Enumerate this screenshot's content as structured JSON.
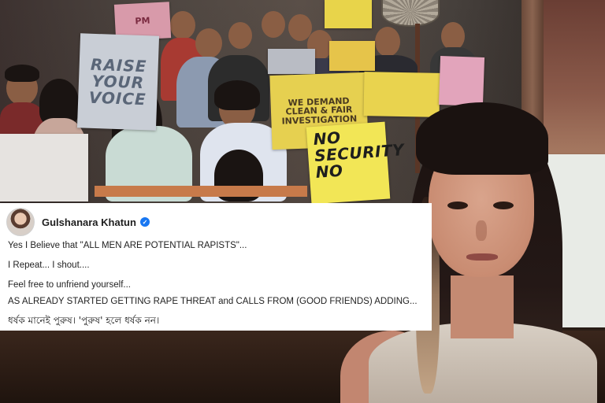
{
  "placards": {
    "raise": "RAISE YOUR VOICE",
    "no_security": "NO SECURITY NO",
    "we_demand": "WE DEMAND CLEAN & FAIR INVESTIGATION"
  },
  "tweet": {
    "author": "Gulshanara Khatun",
    "verified_mark": "✓",
    "lines": [
      "Yes I Believe that \"ALL MEN ARE POTENTIAL RAPISTS\"...",
      "I Repeat... I shout....",
      "Feel free to unfriend yourself...",
      "AS ALREADY STARTED GETTING RAPE THREAT and CALLS FROM (GOOD FRIENDS) ADDING...",
      "ধর্ষক মানেই পুরুষ। 'পুরুষ' হলে ধর্ষক নন।"
    ]
  },
  "colors": {
    "verified": "#1877f2",
    "card_bg": "#ffffff",
    "text": "#1f1f1f"
  }
}
